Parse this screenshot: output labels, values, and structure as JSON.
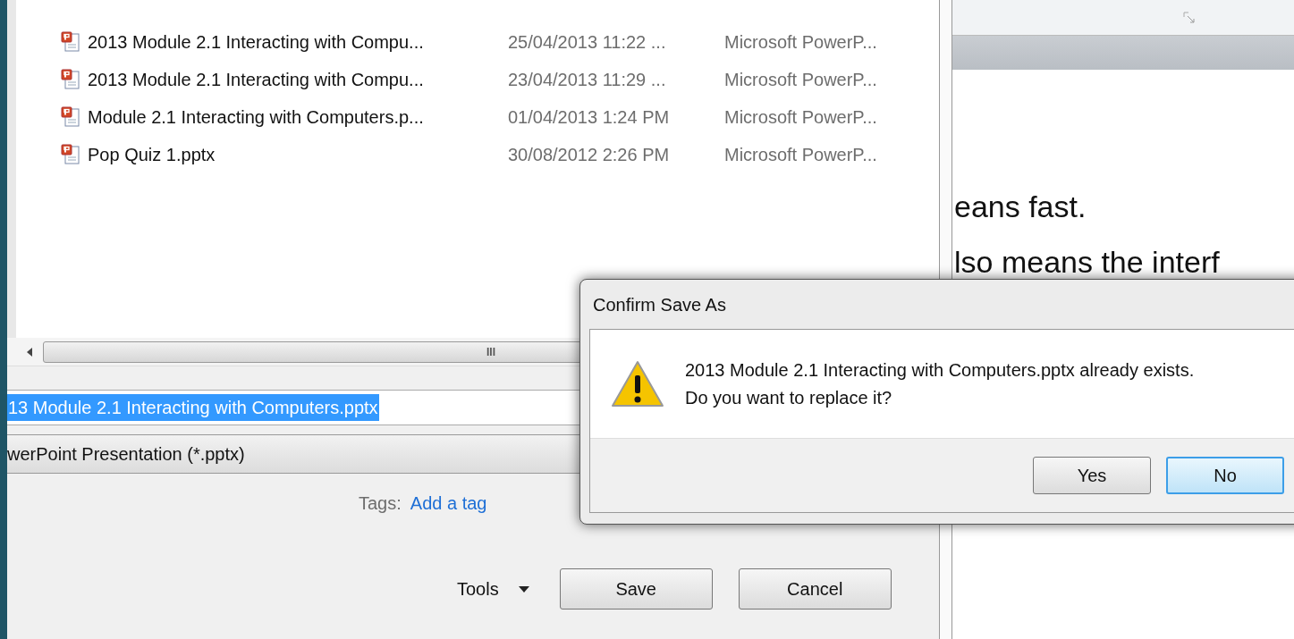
{
  "files": [
    {
      "name": "2013 Module 2.1 Interacting with Compu...",
      "date": "25/04/2013 11:22 ...",
      "type": "Microsoft PowerP..."
    },
    {
      "name": "2013 Module 2.1 Interacting with Compu...",
      "date": "23/04/2013 11:29 ...",
      "type": "Microsoft PowerP..."
    },
    {
      "name": "Module 2.1 Interacting with Computers.p...",
      "date": "01/04/2013 1:24 PM",
      "type": "Microsoft PowerP..."
    },
    {
      "name": "Pop Quiz 1.pptx",
      "date": "30/08/2012 2:26 PM",
      "type": "Microsoft PowerP..."
    }
  ],
  "scroll_grip": "III",
  "file_name": {
    "value": "13 Module 2.1 Interacting with Computers.pptx",
    "selected": true
  },
  "save_as_type": "werPoint Presentation (*.pptx)",
  "tags": {
    "label": "Tags:",
    "link": "Add a tag"
  },
  "tools": "Tools",
  "buttons": [
    "Save",
    "Cancel"
  ],
  "slide_lines": [
    "eans fast.",
    "lso means the interf"
  ],
  "confirm": {
    "title": "Confirm Save As",
    "message": [
      "2013 Module 2.1 Interacting with Computers.pptx already exists.",
      "Do you want to replace it?"
    ],
    "buttons": [
      {
        "label": "Yes",
        "selected": false
      },
      {
        "label": "No",
        "selected": true
      }
    ]
  }
}
